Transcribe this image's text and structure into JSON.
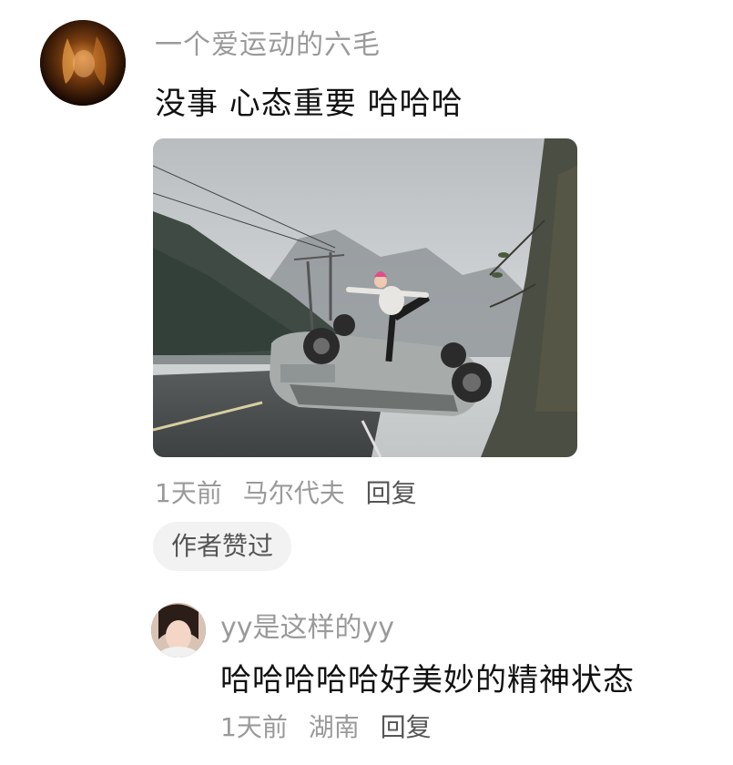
{
  "main_comment": {
    "username": "一个爱运动的六毛",
    "text": "没事 心态重要  哈哈哈",
    "time": "1天前",
    "location": "马尔代夫",
    "reply_label": "回复",
    "badge": "作者赞过"
  },
  "reply_comment": {
    "username": "yy是这样的yy",
    "text": "哈哈哈哈哈好美妙的精神状态",
    "time": "1天前",
    "location": "湖南",
    "reply_label": "回复"
  },
  "colors": {
    "username": "#9a9a9a",
    "text": "#111111",
    "meta": "#9a9a9a",
    "reply": "#555555",
    "badge_bg": "#f2f2f2"
  }
}
